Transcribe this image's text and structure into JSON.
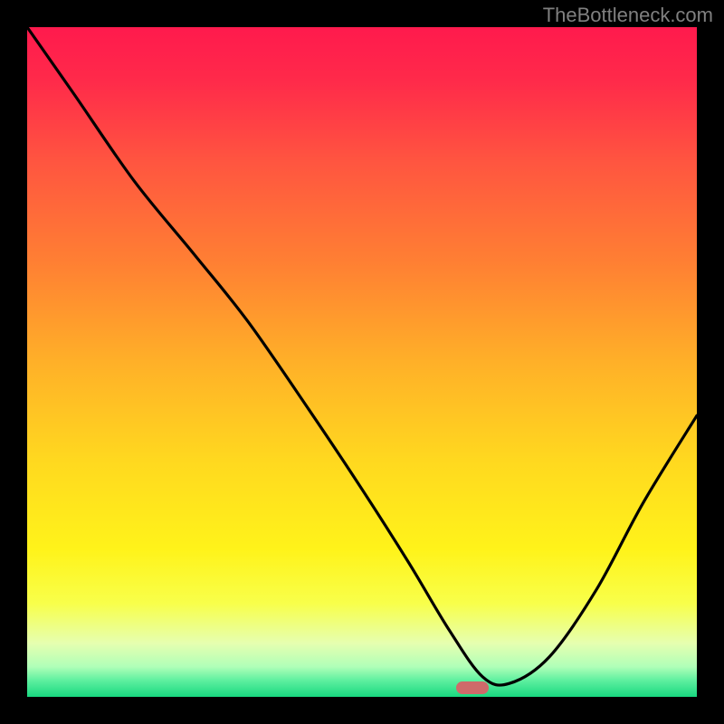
{
  "watermark": "TheBottleneck.com",
  "gradient_stops": [
    {
      "offset": 0.0,
      "color": "#ff1a4d"
    },
    {
      "offset": 0.08,
      "color": "#ff2a4a"
    },
    {
      "offset": 0.2,
      "color": "#ff5540"
    },
    {
      "offset": 0.35,
      "color": "#ff7f33"
    },
    {
      "offset": 0.5,
      "color": "#ffb028"
    },
    {
      "offset": 0.65,
      "color": "#ffd91f"
    },
    {
      "offset": 0.78,
      "color": "#fff31a"
    },
    {
      "offset": 0.86,
      "color": "#f8ff4a"
    },
    {
      "offset": 0.92,
      "color": "#e6ffb0"
    },
    {
      "offset": 0.955,
      "color": "#b0ffb8"
    },
    {
      "offset": 0.975,
      "color": "#60f0a0"
    },
    {
      "offset": 1.0,
      "color": "#18d880"
    }
  ],
  "curve_color": "#000000",
  "curve_width": 3.2,
  "marker": {
    "color": "#cf6a6a",
    "x_frac": 0.665,
    "y_frac": 0.986
  },
  "chart_data": {
    "type": "line",
    "title": "",
    "xlabel": "",
    "ylabel": "",
    "xlim": [
      0,
      1
    ],
    "ylim": [
      0,
      1
    ],
    "note": "Axes are implicit (no tick labels visible). x=normalized horizontal position, y=normalized value where 1=top (red, high bottleneck) and 0=bottom (green, low bottleneck).",
    "series": [
      {
        "name": "bottleneck-curve",
        "x": [
          0.0,
          0.07,
          0.16,
          0.25,
          0.33,
          0.42,
          0.5,
          0.57,
          0.63,
          0.68,
          0.72,
          0.78,
          0.85,
          0.92,
          1.0
        ],
        "values": [
          1.0,
          0.9,
          0.77,
          0.66,
          0.56,
          0.43,
          0.31,
          0.2,
          0.1,
          0.03,
          0.02,
          0.06,
          0.16,
          0.29,
          0.42
        ]
      }
    ],
    "marker_point": {
      "x": 0.665,
      "y": 0.014
    }
  }
}
